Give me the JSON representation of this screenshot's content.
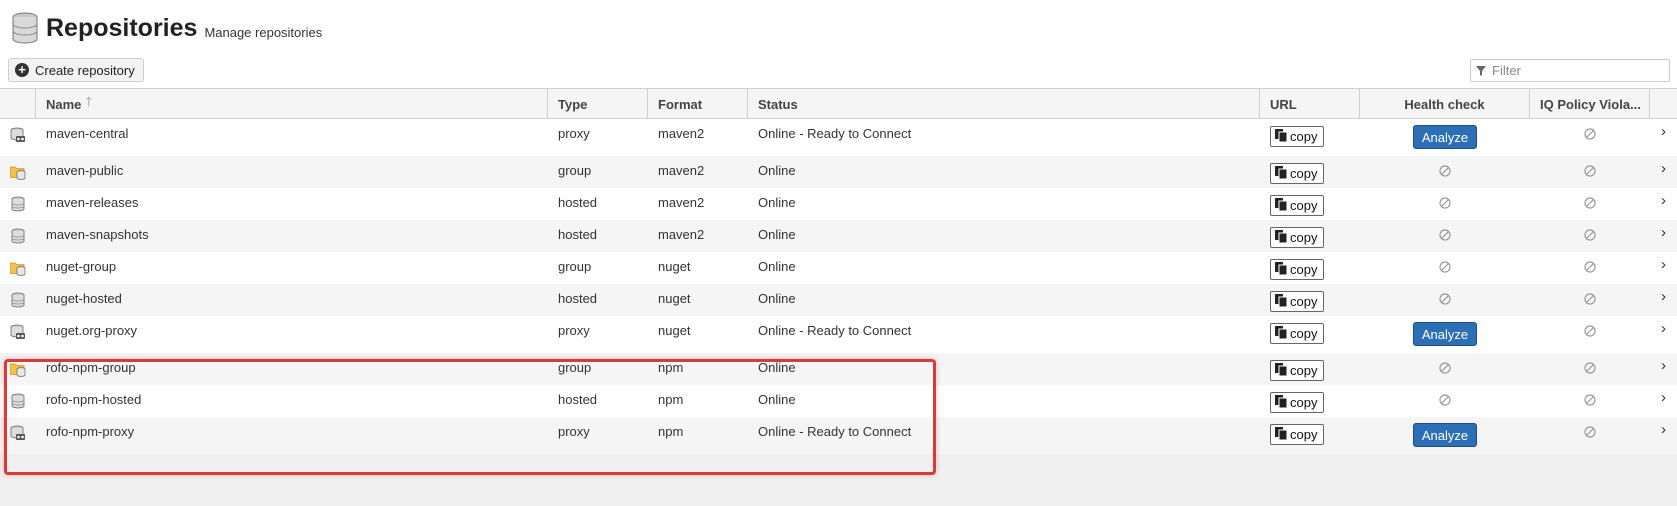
{
  "header": {
    "title": "Repositories",
    "subtitle": "Manage repositories"
  },
  "toolbar": {
    "create_label": "Create repository"
  },
  "filter": {
    "placeholder": "Filter"
  },
  "columns": {
    "name": "Name",
    "type": "Type",
    "format": "Format",
    "status": "Status",
    "url": "URL",
    "health": "Health check",
    "iq": "IQ Policy Viola..."
  },
  "copy_label": "copy",
  "analyze_label": "Analyze",
  "colors": {
    "analyze": "#2c6fb7",
    "highlight": "#d63b3b"
  },
  "rows": [
    {
      "icon": "proxy-repo-icon",
      "name": "maven-central",
      "type": "proxy",
      "format": "maven2",
      "status": "Online - Ready to Connect",
      "health": "analyze"
    },
    {
      "icon": "group-repo-icon",
      "name": "maven-public",
      "type": "group",
      "format": "maven2",
      "status": "Online",
      "health": "disabled"
    },
    {
      "icon": "hosted-repo-icon",
      "name": "maven-releases",
      "type": "hosted",
      "format": "maven2",
      "status": "Online",
      "health": "disabled"
    },
    {
      "icon": "hosted-repo-icon",
      "name": "maven-snapshots",
      "type": "hosted",
      "format": "maven2",
      "status": "Online",
      "health": "disabled"
    },
    {
      "icon": "group-repo-icon",
      "name": "nuget-group",
      "type": "group",
      "format": "nuget",
      "status": "Online",
      "health": "disabled"
    },
    {
      "icon": "hosted-repo-icon",
      "name": "nuget-hosted",
      "type": "hosted",
      "format": "nuget",
      "status": "Online",
      "health": "disabled"
    },
    {
      "icon": "proxy-repo-icon",
      "name": "nuget.org-proxy",
      "type": "proxy",
      "format": "nuget",
      "status": "Online - Ready to Connect",
      "health": "analyze"
    },
    {
      "icon": "group-repo-icon",
      "name": "rofo-npm-group",
      "type": "group",
      "format": "npm",
      "status": "Online",
      "health": "disabled"
    },
    {
      "icon": "hosted-repo-icon",
      "name": "rofo-npm-hosted",
      "type": "hosted",
      "format": "npm",
      "status": "Online",
      "health": "disabled"
    },
    {
      "icon": "proxy-repo-icon",
      "name": "rofo-npm-proxy",
      "type": "proxy",
      "format": "npm",
      "status": "Online - Ready to Connect",
      "health": "analyze"
    }
  ]
}
